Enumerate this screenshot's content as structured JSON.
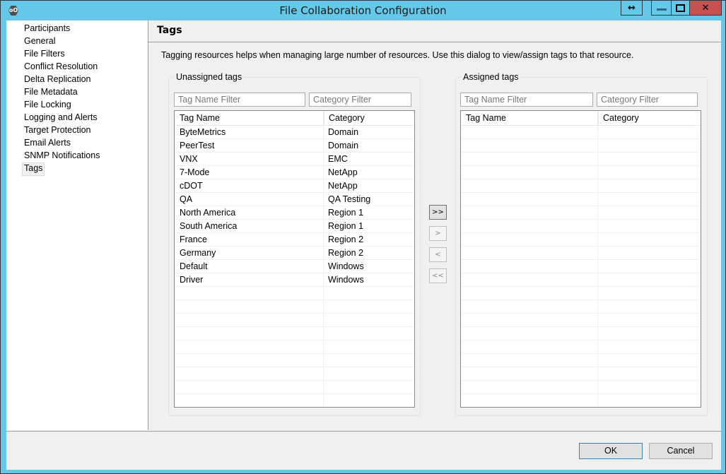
{
  "window": {
    "title": "File Collaboration Configuration",
    "app_icon": "peer-logo-icon",
    "controls": {
      "resize": "↔",
      "minimize": "minimize-icon",
      "maximize": "maximize-icon",
      "close": "x"
    }
  },
  "sidebar": {
    "items": [
      {
        "label": "Participants"
      },
      {
        "label": "General"
      },
      {
        "label": "File Filters"
      },
      {
        "label": "Conflict Resolution"
      },
      {
        "label": "Delta Replication"
      },
      {
        "label": "File Metadata"
      },
      {
        "label": "File Locking"
      },
      {
        "label": "Logging and Alerts"
      },
      {
        "label": "Target Protection"
      },
      {
        "label": "Email Alerts"
      },
      {
        "label": "SNMP Notifications"
      },
      {
        "label": "Tags",
        "selected": true
      }
    ]
  },
  "main": {
    "title": "Tags",
    "description": "Tagging resources helps when managing large number of resources. Use this dialog to view/assign tags to that resource.",
    "unassigned": {
      "label": "Unassigned tags",
      "tag_filter_placeholder": "Tag Name Filter",
      "category_filter_placeholder": "Category Filter",
      "columns": [
        "Tag Name",
        "Category"
      ],
      "rows": [
        [
          "ByteMetrics",
          "Domain"
        ],
        [
          "PeerTest",
          "Domain"
        ],
        [
          "VNX",
          "EMC"
        ],
        [
          "7-Mode",
          "NetApp"
        ],
        [
          "cDOT",
          "NetApp"
        ],
        [
          "QA",
          "QA Testing"
        ],
        [
          "North America",
          "Region 1"
        ],
        [
          "South America",
          "Region 1"
        ],
        [
          "France",
          "Region 2"
        ],
        [
          "Germany",
          "Region 2"
        ],
        [
          "Default",
          "Windows"
        ],
        [
          "Driver",
          "Windows"
        ]
      ]
    },
    "transfer_buttons": {
      "assign_all": ">>",
      "assign_selected": ">",
      "unassign_selected": "<",
      "unassign_all": "<<"
    },
    "assigned": {
      "label": "Assigned tags",
      "tag_filter_placeholder": "Tag Name Filter",
      "category_filter_placeholder": "Category Filter",
      "columns": [
        "Tag Name",
        "Category"
      ],
      "rows": []
    }
  },
  "footer": {
    "ok_label": "OK",
    "cancel_label": "Cancel"
  }
}
